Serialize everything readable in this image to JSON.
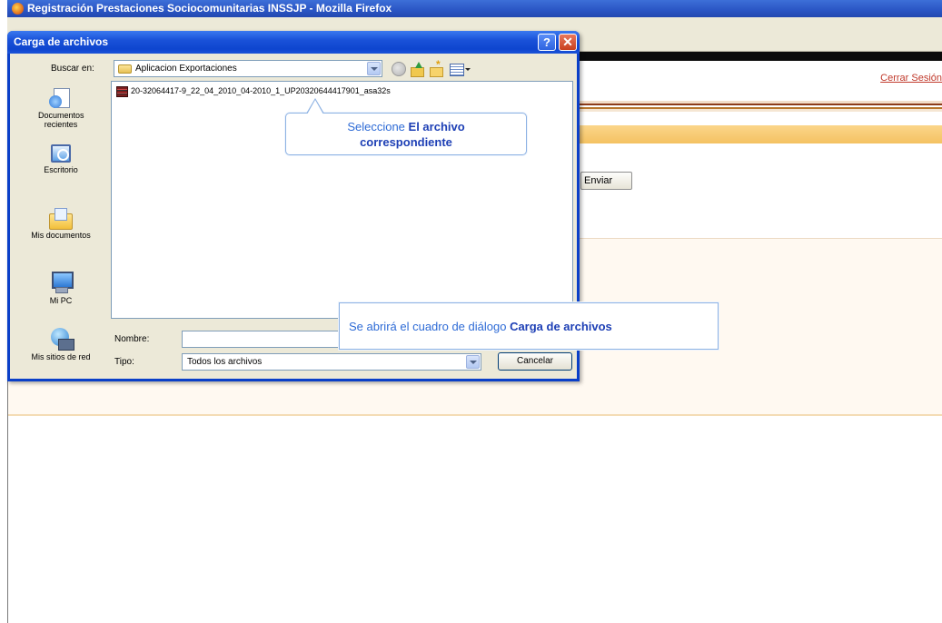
{
  "browser": {
    "title": "Registración Prestaciones Sociocomunitarias INSSJP - Mozilla Firefox"
  },
  "page": {
    "logout_link": "Cerrar Sesión",
    "send_button": "Enviar"
  },
  "dialog": {
    "title": "Carga de archivos",
    "help_button": "?",
    "close_button": "✕",
    "look_in_label": "Buscar en:",
    "look_in_value": "Aplicacion Exportaciones",
    "places": [
      {
        "label": "Documentos recientes",
        "icon": "recent-documents-icon"
      },
      {
        "label": "Escritorio",
        "icon": "desktop-icon"
      },
      {
        "label": "Mis documentos",
        "icon": "my-documents-icon"
      },
      {
        "label": "Mi PC",
        "icon": "my-computer-icon"
      },
      {
        "label": "Mis sitios de red",
        "icon": "network-places-icon"
      }
    ],
    "files": [
      {
        "name": "20-32064417-9_22_04_2010_04-2010_1_UP20320644417901_asa32s",
        "icon": "archive-file-icon"
      }
    ],
    "name_label": "Nombre:",
    "name_value": "",
    "type_label": "Tipo:",
    "type_value": "Todos los archivos",
    "cancel_button": "Cancelar"
  },
  "callouts": {
    "select_prefix": "Seleccione ",
    "select_bold": "El archivo",
    "select_line2": "correspondiente",
    "open_prefix": "Se abrirá el cuadro de diálogo ",
    "open_bold": "Carga de archivos"
  },
  "colors": {
    "dialog_border": "#0a3fc8",
    "callout_text": "#2e6bd6",
    "callout_bold": "#1d3fb5",
    "logout_link": "#c0392b",
    "orange_band": "#f4c262"
  }
}
